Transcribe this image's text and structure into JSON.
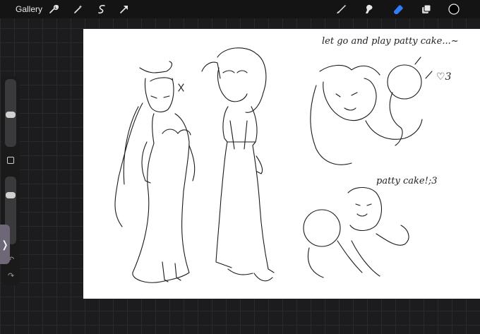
{
  "toolbar": {
    "gallery_label": "Gallery",
    "left_tools": [
      "wrench-icon",
      "magic-wand-icon",
      "selection-icon",
      "transform-arrow-icon"
    ],
    "right_tools": [
      "brush-icon",
      "smudge-icon",
      "eraser-icon",
      "layers-icon",
      "color-swatch"
    ],
    "active_tool": "eraser-icon",
    "accent_color": "#2f7cf6",
    "current_color": "#000000"
  },
  "sidebar": {
    "brush_size_level": 0.55,
    "opacity_level": 0.25
  },
  "canvas": {
    "caption_top": "let go and play patty cake...~",
    "caption_bottom": "patty cake!;3",
    "heart_note": "♡3"
  }
}
